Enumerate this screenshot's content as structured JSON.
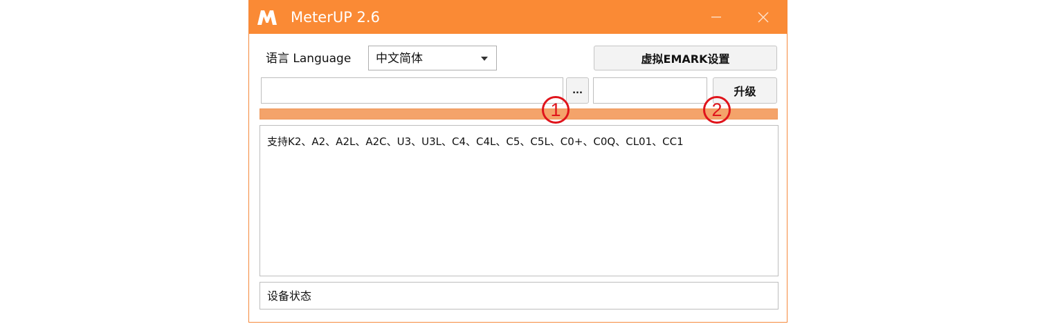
{
  "window": {
    "title": "MeterUP 2.6",
    "accent_color": "#fa8a35",
    "logo_icon": "meterup-m-logo",
    "minimize_icon": "minimize-icon",
    "close_icon": "close-icon"
  },
  "language": {
    "label": "语言 Language",
    "selected": "中文简体"
  },
  "buttons": {
    "emark": "虚拟EMARK设置",
    "browse": "...",
    "upgrade": "升级"
  },
  "inputs": {
    "file_path_value": "",
    "device_value": ""
  },
  "progress": {
    "value_percent": 100,
    "color": "#f4a36a"
  },
  "log": {
    "text": "支持K2、A2、A2L、A2C、U3、U3L、C4、C4L、C5、C5L、C0+、C0Q、CL01、CC1"
  },
  "status": {
    "text": "设备状态"
  },
  "annotations": [
    {
      "label": "1",
      "color": "#e0141b"
    },
    {
      "label": "2",
      "color": "#e0141b"
    }
  ]
}
